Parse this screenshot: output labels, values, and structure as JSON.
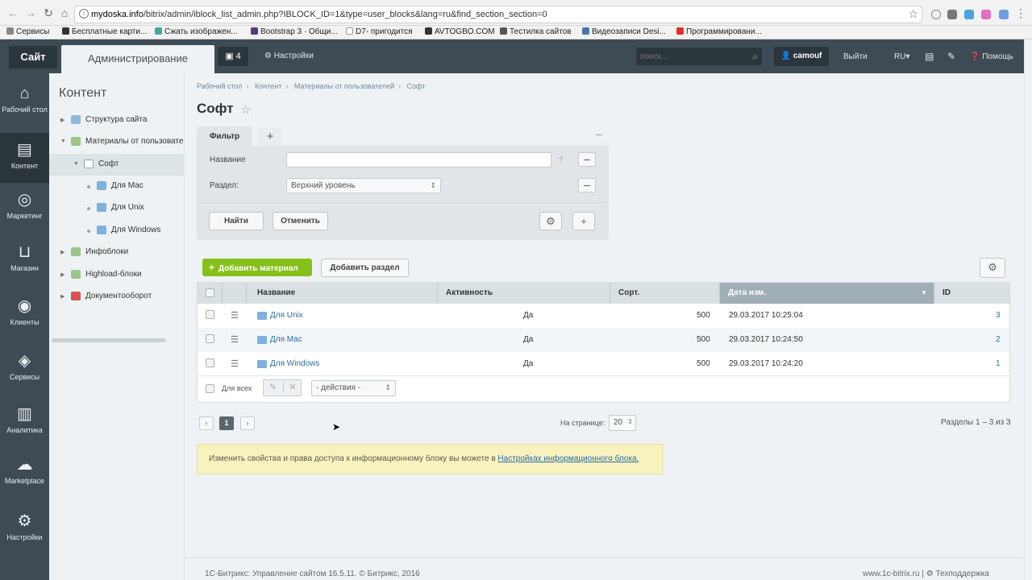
{
  "browser": {
    "url_host": "mydoska.info",
    "url_path": "/bitrix/admin/iblock_list_admin.php?IBLOCK_ID=1&type=user_blocks&lang=ru&find_section_section=0",
    "bookmarks": [
      "Сервисы",
      "Бесплатные карти...",
      "Сжать изображен...",
      "Bootstrap 3 · Общи...",
      "D7- пригодится",
      "AVTOGBO.COM",
      "Тестилка сайтов",
      "Видеозаписи Desi...",
      "Программировани..."
    ]
  },
  "topbar": {
    "site_tab": "Сайт",
    "admin_tab": "Администрирование",
    "notifications_count": "4",
    "settings_label": "Настройки",
    "search_placeholder": "поиск...",
    "user": "camouf",
    "logout": "Выйти",
    "lang": "RU",
    "help": "Помощь"
  },
  "leftnav": [
    {
      "label": "Рабочий стол",
      "icon": "home-icon"
    },
    {
      "label": "Контент",
      "icon": "document-icon"
    },
    {
      "label": "Маркетинг",
      "icon": "target-icon"
    },
    {
      "label": "Магазин",
      "icon": "basket-icon"
    },
    {
      "label": "Клиенты",
      "icon": "clients-icon"
    },
    {
      "label": "Сервисы",
      "icon": "layers-icon"
    },
    {
      "label": "Аналитика",
      "icon": "chart-icon"
    },
    {
      "label": "Marketplace",
      "icon": "cloud-download-icon"
    },
    {
      "label": "Настройки",
      "icon": "gear-icon"
    }
  ],
  "sidebar": {
    "title": "Контент",
    "items": [
      {
        "label": "Структура сайта"
      },
      {
        "label": "Материалы от пользовате"
      },
      {
        "label": "Софт"
      },
      {
        "label": "Для Mac"
      },
      {
        "label": "Для Unix"
      },
      {
        "label": "Для Windows"
      },
      {
        "label": "Инфоблоки"
      },
      {
        "label": "Highload-блоки"
      },
      {
        "label": "Документооборот"
      }
    ]
  },
  "main": {
    "breadcrumbs": [
      "Рабочий стол",
      "Контент",
      "Материалы от пользователей",
      "Софт"
    ],
    "title": "Софт",
    "filter": {
      "tab_label": "Фильтр",
      "name_label": "Название",
      "name_value": "",
      "section_label": "Раздел:",
      "section_value": "Верхний уровень",
      "find_button": "Найти",
      "cancel_button": "Отменить"
    },
    "add_material_button": "Добавить материал",
    "add_section_button": "Добавить раздел",
    "table": {
      "columns": [
        "Название",
        "Активность",
        "Сорт.",
        "Дата изм.",
        "ID"
      ],
      "rows": [
        {
          "name": "Для Unix",
          "active": "Да",
          "sort": "500",
          "date": "29.03.2017 10:25:04",
          "id": "3"
        },
        {
          "name": "Для Mac",
          "active": "Да",
          "sort": "500",
          "date": "29.03.2017 10:24:50",
          "id": "2"
        },
        {
          "name": "Для Windows",
          "active": "Да",
          "sort": "500",
          "date": "29.03.2017 10:24:20",
          "id": "1"
        }
      ],
      "for_all_label": "Для всех",
      "actions_value": "- действия -"
    },
    "pagination": {
      "current_page": "1",
      "per_page_label": "На странице:",
      "per_page_value": "20",
      "total": "Разделы 1 – 3 из 3"
    },
    "notice": {
      "text": "Изменить свойства и права доступа к информационному блоку вы можете в ",
      "link": "Настройках информационного блока."
    }
  },
  "footer": {
    "copyright": "1С-Битрикс: Управление сайтом 16.5.11. © Битрикс, 2016",
    "site_link": "www.1c-bitrix.ru",
    "support": "Техподдержка"
  }
}
